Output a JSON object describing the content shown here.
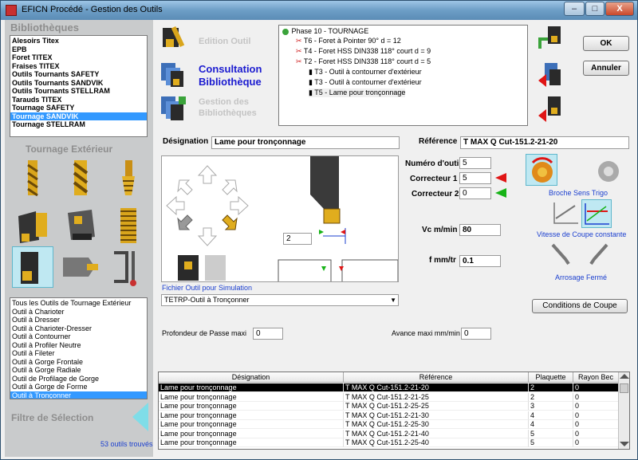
{
  "window": {
    "title": "EFICN Procédé - Gestion des Outils",
    "min": "–",
    "max": "□",
    "close": "X"
  },
  "libraries": {
    "heading": "Bibliothèques",
    "items": [
      "Alesoirs Titex",
      "EPB",
      "Foret TITEX",
      "Fraises TITEX",
      "Outils Tournants SAFETY",
      "Outils Tournants SANDVIK",
      "Outils Tournants STELLRAM",
      "Tarauds TITEX",
      "Tournage  SAFETY",
      "Tournage SANDVIK",
      "Tournage STELLRAM"
    ],
    "selected_index": 9
  },
  "category": {
    "heading": "Tournage Extérieur",
    "tool_types": [
      "Tous les Outils de Tournage Extérieur",
      "Outil à Charioter",
      "Outil à Dresser",
      "Outil à Charioter-Dresser",
      "Outil à Contourner",
      "Outil à Profiler Neutre",
      "Outil à Fileter",
      "Outil à Gorge Frontale",
      "Outil à Gorge Radiale",
      "Outil de Profilage de Gorge",
      "Outil à Gorge de Forme",
      "Outil à Tronçonner"
    ],
    "selected_index": 11
  },
  "filter": {
    "label": "Filtre de Sélection",
    "count": "53 outils trouvés"
  },
  "modes": {
    "edit": [
      "Edition Outil"
    ],
    "consult": [
      "Consultation",
      "Bibliothèque"
    ],
    "manage": [
      "Gestion des",
      "Bibliothèques"
    ]
  },
  "phase_tree": {
    "phase": "Phase 10 - TOURNAGE",
    "items": [
      "T6 - Foret à Pointer 90° d = 12",
      "T4 - Foret HSS DIN338 118° court d = 9",
      "T2 - Foret HSS DIN338 118° court d = 5",
      "T3 - Outil à contourner d'extérieur",
      "T3 - Outil à contourner d'extérieur",
      "T5 - Lame pour tronçonnage"
    ]
  },
  "buttons": {
    "ok": "OK",
    "cancel": "Annuler",
    "cutting": "Conditions de Coupe"
  },
  "tool": {
    "designation_label": "Désignation",
    "designation": "Lame pour tronçonnage",
    "reference_label": "Référence",
    "reference": "T MAX Q Cut-151.2-21-20",
    "tool_number_label": "Numéro d'outil",
    "tool_number": "5",
    "corrector1_label": "Correcteur 1",
    "corrector1": "5",
    "corrector2_label": "Correcteur 2",
    "corrector2": "0",
    "vc_label": "Vc m/min",
    "vc": "80",
    "f_label": "f mm/tr",
    "f": "0.1",
    "offset_value": "2",
    "sim_file_label": "Fichier Outil pour Simulation",
    "sim_file": "TETRP-Outil à Tronçonner",
    "depth_label": "Profondeur de Passe maxi",
    "depth": "0",
    "feed_label": "Avance maxi mm/min",
    "feed": "0"
  },
  "options": {
    "spindle": "Broche Sens Trigo",
    "speed": "Vitesse de Coupe constante",
    "coolant": "Arrosage Fermé"
  },
  "colors": {
    "red_marker": "#e01515",
    "green_marker": "#17b317",
    "blue_text": "#1b3fcf",
    "selection": "#3399ff"
  },
  "grid": {
    "headers": [
      "Désignation",
      "Référence",
      "Plaquette",
      "Rayon Bec"
    ],
    "rows": [
      [
        "Lame pour tronçonnage",
        "T MAX Q Cut-151.2-21-20",
        "2",
        "0"
      ],
      [
        "Lame pour tronçonnage",
        "T MAX Q Cut-151.2-21-25",
        "2",
        "0"
      ],
      [
        "Lame pour tronçonnage",
        "T MAX Q Cut-151.2-25-25",
        "3",
        "0"
      ],
      [
        "Lame pour tronçonnage",
        "T MAX Q Cut-151.2-21-30",
        "4",
        "0"
      ],
      [
        "Lame pour tronçonnage",
        "T MAX Q Cut-151.2-25-30",
        "4",
        "0"
      ],
      [
        "Lame pour tronçonnage",
        "T MAX Q Cut-151.2-21-40",
        "5",
        "0"
      ],
      [
        "Lame pour tronçonnage",
        "T MAX Q Cut-151.2-25-40",
        "5",
        "0"
      ]
    ],
    "selected_index": 0
  }
}
